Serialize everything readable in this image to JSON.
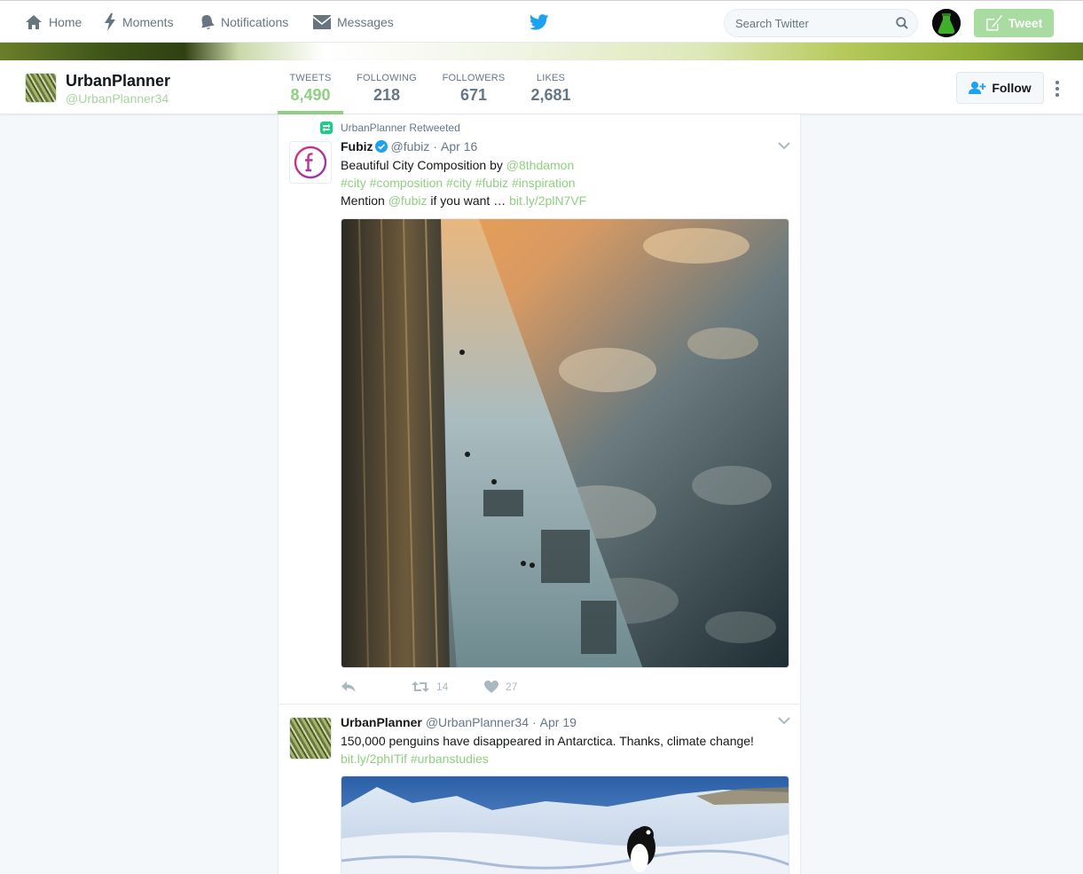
{
  "nav": {
    "home": "Home",
    "moments": "Moments",
    "notifications": "Notifications",
    "messages": "Messages",
    "search_placeholder": "Search Twitter",
    "tweet_button": "Tweet"
  },
  "profile": {
    "name": "UrbanPlanner",
    "handle": "@UrbanPlanner34",
    "stats": {
      "tweets_label": "TWEETS",
      "tweets_value": "8,490",
      "following_label": "FOLLOWING",
      "following_value": "218",
      "followers_label": "FOLLOWERS",
      "followers_value": "671",
      "likes_label": "LIKES",
      "likes_value": "2,681"
    },
    "follow_label": "Follow"
  },
  "tweets": [
    {
      "retweet_notice": "UrbanPlanner Retweeted",
      "name": "Fubiz",
      "handle": "@fubiz",
      "dot": "·",
      "date": "Apr 16",
      "line1_text": "Beautiful City Composition by ",
      "line1_link": "@8thdamon",
      "line2_hashtags": "#city #composition #city #fubiz #inspiration",
      "line3_text": "Mention ",
      "line3_mention": "@fubiz",
      "line3_rest": " if you want … ",
      "line3_link": "bit.ly/2plN7VF",
      "retweets": "14",
      "likes": "27"
    },
    {
      "name": "UrbanPlanner",
      "handle": "@UrbanPlanner34",
      "dot": "·",
      "date": "Apr 19",
      "line1_text": "150,000 penguins have disappeared in Antarctica. Thanks, climate change!",
      "line2_link": "bit.ly/2phITif",
      "line2_hashtag": "#urbanstudies"
    }
  ],
  "colors": {
    "accent": "#8ed081",
    "tweet_button": "#a8dca0",
    "twitter_blue": "#1da1f2"
  }
}
